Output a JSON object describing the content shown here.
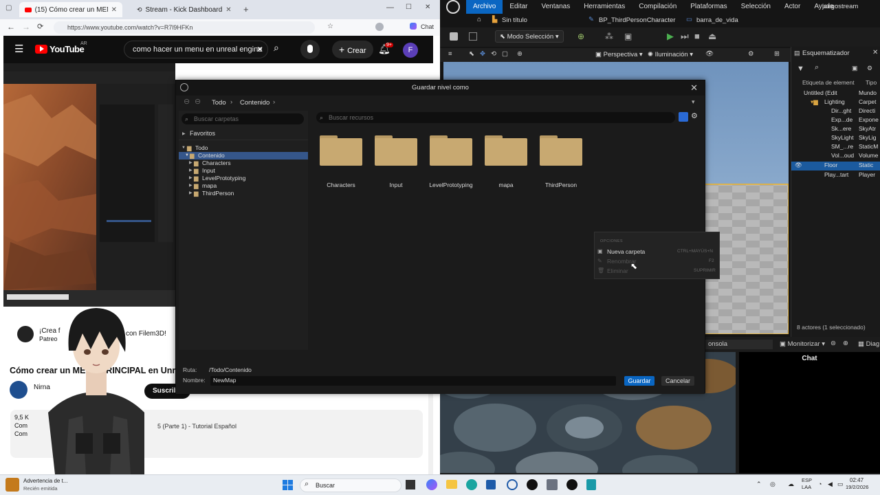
{
  "browser": {
    "tabs": [
      {
        "label": "(15) Cómo crear un MENÚ PR"
      },
      {
        "label": "Stream - Kick Dashboard"
      }
    ],
    "url": "https://www.youtube.com/watch?v=R7l9HFKn",
    "chat_label": "Chat"
  },
  "youtube": {
    "logo": "YouTube",
    "region": "AR",
    "search_query": "como hacer un menu en unreal engine",
    "create_label": "Crear",
    "notif_count": "9+",
    "avatar_letter": "F",
    "video_title": "Cómo crear un MENÚ PRINCIPAL en Unr",
    "channel_name": "Nirna",
    "subscribe_label": "Suscribir",
    "comment_snippet1": "¡Crea f",
    "comment_snippet2": "Patreo",
    "comment_right": "con Filem3D!",
    "views": "9,5 K",
    "desc_line1": "Com",
    "desc_line2": "Com",
    "related_title": "5 (Parte 1) - Tutorial Español"
  },
  "ue": {
    "menu": [
      "Archivo",
      "Editar",
      "Ventanas",
      "Herramientas",
      "Compilación",
      "Plataformas",
      "Selección",
      "Actor",
      "Ayuda"
    ],
    "project": "juegostream",
    "tabs": [
      "Sin título",
      "BP_ThirdPersonCharacter",
      "barra_de_vida"
    ],
    "mode": "Modo Selección",
    "viewport_perspective": "Perspectiva",
    "viewport_lighting": "Iluminación",
    "outliner_title": "Esquematizador",
    "outliner_header_label": "Etiqueta de element",
    "outliner_header_type": "Tipo",
    "outliner_rows": [
      {
        "name": "Untitled (Edit",
        "type": "Mundo"
      },
      {
        "name": "Lighting",
        "type": "Carpet"
      },
      {
        "name": "Dir...ght",
        "type": "Directi"
      },
      {
        "name": "Exp...de",
        "type": "Expone"
      },
      {
        "name": "Sk...ere",
        "type": "SkyAtr"
      },
      {
        "name": "SkyLight",
        "type": "SkyLig"
      },
      {
        "name": "SM_...re",
        "type": "StaticM"
      },
      {
        "name": "Vol...oud",
        "type": "Volume"
      },
      {
        "name": "Floor",
        "type": "Static"
      },
      {
        "name": "Play...tart",
        "type": "Player"
      }
    ],
    "actor_count": "8 actores (1 seleccionado)",
    "console": "onsola",
    "monitor": "Monitorizar",
    "diag": "Diag",
    "chat_title": "Chat"
  },
  "dialog": {
    "title": "Guardar nivel como",
    "breadcrumb": [
      "Todo",
      "Contenido"
    ],
    "folder_search_placeholder": "Buscar carpetas",
    "asset_search_placeholder": "Buscar recursos",
    "favorites_label": "Favoritos",
    "tree": [
      {
        "label": "Todo",
        "level": 0
      },
      {
        "label": "Contenido",
        "level": 1,
        "selected": true
      },
      {
        "label": "Characters",
        "level": 2
      },
      {
        "label": "Input",
        "level": 2
      },
      {
        "label": "LevelPrototyping",
        "level": 2
      },
      {
        "label": "mapa",
        "level": 2
      },
      {
        "label": "ThirdPerson",
        "level": 2
      }
    ],
    "folders": [
      "Characters",
      "Input",
      "LevelPrototyping",
      "mapa",
      "ThirdPerson"
    ],
    "context_menu": {
      "section": "OPCIONES",
      "items": [
        {
          "label": "Nueva carpeta",
          "shortcut": "CTRL+MAYÚS+N",
          "enabled": true
        },
        {
          "label": "Renombrar",
          "shortcut": "F2",
          "enabled": false
        },
        {
          "label": "Eliminar",
          "shortcut": "SUPRIMIR",
          "enabled": false
        }
      ]
    },
    "path_label": "Ruta:",
    "path_value": "/Todo/Contenido",
    "name_label": "Nombre:",
    "name_value": "NewMap",
    "save_label": "Guardar",
    "cancel_label": "Cancelar"
  },
  "taskbar": {
    "notification_title": "Advertencia de t...",
    "notification_sub": "Recién emitida",
    "search_label": "Buscar",
    "lang_line1": "ESP",
    "lang_line2": "LAA",
    "time": "02:47",
    "date": "19/2/2026"
  },
  "colors": {
    "accent_blue": "#0a66c2",
    "dialog_bg": "#1b1b1b",
    "folder": "#c8a971",
    "youtube_red": "#ff0000"
  }
}
